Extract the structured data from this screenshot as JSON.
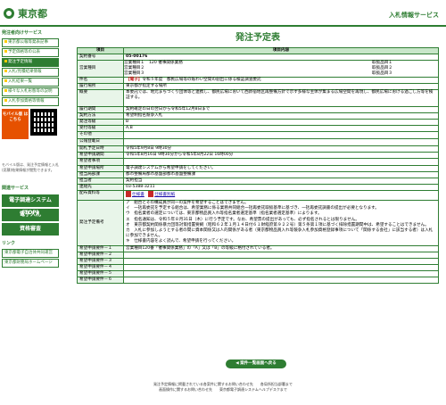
{
  "header": {
    "logo": "東京都",
    "service_title": "入札情報サービス"
  },
  "sidebar": {
    "section1": "発注者向けサービス",
    "items": [
      "東京都公報等発表記事",
      "予定価格等の公表",
      "発注予定情報",
      "入札/見積結果情報",
      "入札結果一覧",
      "様々な入札形態等の説明",
      "入札参加資格等情報"
    ],
    "mobile_badge": "モバイル版 はこちら",
    "mobile_note": "モバイル版は、発注予定情報と入札(見積)結果情報が閲覧できます。",
    "section2": "関連サービス",
    "big_items": [
      "電子調達システム(TOP)",
      "電子入札",
      "資格審査"
    ],
    "section3": "リンク",
    "links": [
      "東京都電子自治体共同運営",
      "東京都財務局ホームページ"
    ]
  },
  "main": {
    "title": "発注予定表",
    "col_item": "項目",
    "col_content": "項目内容",
    "rows": {
      "contract_no_label": "契約番号",
      "contract_no": "05-00176",
      "category_label": "営業種目",
      "category1": "営業種目１",
      "category1_value": "120 催事関係業務",
      "category2": "営業種目２",
      "category3": "営業種目３",
      "subcat1": "取扱品目１",
      "subcat2": "取扱品目２",
      "subcat3": "取扱品目３",
      "subject_label": "件名",
      "subject_tag": "【電子】",
      "subject": "令和５年度　都民広場等の賑わい空間の創出に係る検証調査委託",
      "place_label": "履行場所",
      "place": "東京都が指定する場所",
      "summary_label": "概要",
      "summary": "本委託では、地元まちづくり団体等と連携し、都民広場において西新宿地区再整備方針で示す多様な主体が集まる広場空間を再現し、都民広場における過ごし方等を検証する。",
      "period_label": "履行期間",
      "period": "契約確定の日の翌日から令和5年12月8日まで",
      "method_label": "契約方法",
      "method": "希望制指名競争入札",
      "bureau_label": "発注等級",
      "bureau": "B",
      "grade_label": "受付等級",
      "grade": "A,B",
      "other_label": "その他",
      "other": "",
      "pub_date_label": "公報登載日",
      "pub_date": "",
      "open_label": "開札予定日時",
      "open": "令和5年9月8日 9時30分",
      "apply_label": "希望申請期間",
      "apply": "令和5年8月16日 9時30分から令和5年8月22日 16時00分",
      "req_label": "希望者事項",
      "req": "",
      "apply_method_label": "希望申請場所",
      "apply_method": "電子調達システムから希望申請をしてください。",
      "dept_label": "担当局部課",
      "dept": "都市整備局都市基盤部都市基盤整備課",
      "person_label": "担当者",
      "person": "契約担当",
      "tel_label": "連絡先",
      "tel": "03-5388-3211",
      "docs_label": "配布資料等",
      "doc1": "仕様書",
      "doc2": "仕様書別紙",
      "notes_label": "発注予定備考",
      "notes": "ア　組合とその構成員が同一の案件を希望することはできません。\nイ　一括再委託を予定する組合は、希望業務に係る業務共同組合一括再委託取扱基準に基づき、一括再委託調書の提出が必要となります。\nウ　指名業者の選定については、東京都物品買入れ等指名業者選定基準（指名業者選定基準）によります。\nエ　指名通知は、令和５年８月31日（木）に行う予定です。なお、希望票の提出があっても、必ず指名されるとは限りません。\nオ　東京都契約関係暴力団等対策措置要綱（昭和６２年１月１４日付６１財経庶第９２２号）第５条第１項に基づく排除措置期間中は、希望することはできません。\nカ　入札に参加しようとする者の間に資本関係又は人的関係がある者（東京都物品買入れ等競争入札参加資格登録事項について「関係する会社」に該当する者）は入札に参加できません。\nキ　仕様書内容をよく読んで、希望申請を行ってください。",
      "req_items": [
        {
          "label": "希望申請要件－１",
          "value": "営業種目120番「催事関係業務」の「A」又は「B」の等級に格付されている者。"
        },
        {
          "label": "希望申請要件－２",
          "value": ""
        },
        {
          "label": "希望申請要件－３",
          "value": ""
        },
        {
          "label": "希望申請要件－４",
          "value": ""
        },
        {
          "label": "希望申請要件－５",
          "value": ""
        },
        {
          "label": "希望申請要件－６",
          "value": ""
        }
      ]
    },
    "list_button": "案件一覧画面へ戻る"
  },
  "footer": {
    "line1": "発注予定情報に掲載されている各案件に関するお問い合わせ先　　各局所担当部署まで",
    "line2": "画面操作に関するお問い合わせ先　　東京都電子調達システムヘルプデスクまで"
  },
  "colors": {
    "accent": "#2e7d32",
    "header_bg": "#c8e6c9",
    "label_bg": "#e8f5e9",
    "red": "#c62828"
  }
}
